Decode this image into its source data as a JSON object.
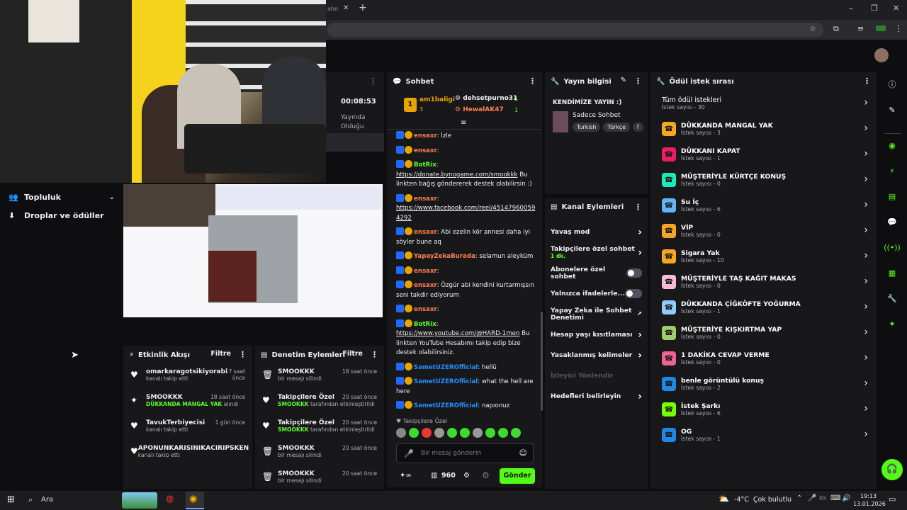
{
  "browser": {
    "tab_fragment": "ahn",
    "new_tab": "+",
    "close_tab": "✕"
  },
  "left_nav": {
    "items": [
      {
        "label": "Topluluk"
      },
      {
        "label": "Droplar ve ödüller"
      }
    ]
  },
  "stream_status": {
    "time": "00:08:53",
    "label": "Yayında\nOlduğu"
  },
  "chat": {
    "title": "Sohbet",
    "leaders": [
      {
        "rank": "1",
        "name": "am1baligi",
        "count": "3"
      },
      {
        "name": "dehsetpurno31",
        "count": "1"
      },
      {
        "name": "HewalAK47",
        "count": "1"
      }
    ],
    "messages": [
      {
        "user": "ensaxr",
        "user_color": "#ff7f50",
        "text": ": İzle"
      },
      {
        "user": "ensaxr",
        "user_color": "#ff7f50",
        "text": ":"
      },
      {
        "user": "BotRix",
        "user_color": "#5cff2a",
        "text": ":",
        "link": "https://donate.bynogame.com/smookkk",
        "after": " Bu linkten bağış göndererek destek olabilirsin :)"
      },
      {
        "user": "ensaxr",
        "user_color": "#ff7f50",
        "text": ":",
        "link": "https://www.facebook.com/reel/451479600594292",
        "after": ""
      },
      {
        "user": "ensaxr",
        "user_color": "#ff7f50",
        "text": ": Abi ezelin kör annesi daha iyi söyler bune aq"
      },
      {
        "user": "YapayZekaBurada",
        "user_color": "#ff7f50",
        "text": ": selamun aleyküm"
      },
      {
        "user": "ensaxr",
        "user_color": "#ff7f50",
        "text": ":"
      },
      {
        "user": "ensaxr",
        "user_color": "#ff7f50",
        "text": ": Özgür abi kendini kurtarmışsın seni takdir ediyorum"
      },
      {
        "user": "ensaxr",
        "user_color": "#ff7f50",
        "text": ":"
      },
      {
        "user": "BotRix",
        "user_color": "#5cff2a",
        "text": ":",
        "link": "https://www.youtube.com/@HARD-1men",
        "after": " Bu linkten YouTube Hesabımı takip edip bize destek olabilirsiniz."
      },
      {
        "user": "SametUZEROfficial",
        "user_color": "#1e90ff",
        "text": ": hellü"
      },
      {
        "user": "SametUZEROfficial",
        "user_color": "#1e90ff",
        "text": ": what the hell are here"
      },
      {
        "user": "SametUZEROfficial",
        "user_color": "#1e90ff",
        "text": ": napıonuz"
      }
    ],
    "emote_label": "Takipçilere Özel",
    "input_placeholder": "Bir mesaj gönderin",
    "points": "960",
    "send_label": "Gönder"
  },
  "stream_info": {
    "title": "Yayın bilgisi",
    "stream_title": "KENDİMİZE YAYIN :)",
    "category": "Sadece Sohbet",
    "tags": [
      "Turkish",
      "Türkçe",
      "f"
    ]
  },
  "channel_actions": {
    "title": "Kanal Eylemleri",
    "items": [
      {
        "label": "Yavaş mod",
        "control": "chevron"
      },
      {
        "label": "Takipçilere özel sohbet",
        "sub": "1 dk.",
        "control": "chevron"
      },
      {
        "label": "Abonelere özel sohbet",
        "control": "toggle"
      },
      {
        "label": "Yalnızca ifadelerle...",
        "control": "toggle"
      },
      {
        "label": "Yapay Zeka ile Sohbet Denetimi",
        "control": "external"
      },
      {
        "label": "Hesap yaşı kısıtlaması",
        "control": "chevron"
      },
      {
        "label": "Yasaklanmış kelimeler",
        "control": "chevron"
      },
      {
        "label": "İzleyici Yönlendir",
        "control": "none",
        "disabled": true
      },
      {
        "label": "Hedefleri belirleyin",
        "control": "chevron"
      }
    ]
  },
  "reward_queue": {
    "title": "Ödül istek sırası",
    "all_label": "Tüm ödül istekleri",
    "all_count": "İstek sayısı - 30",
    "rewards": [
      {
        "title": "DÜKKANDA MANGAL YAK",
        "count": "İstek sayısı - 3",
        "color": "#f5a623"
      },
      {
        "title": "DÜKKANI KAPAT",
        "count": "İstek sayısı - 1",
        "color": "#e91e63"
      },
      {
        "title": "MÜŞTERİYLE KÜRTÇE KONUŞ",
        "count": "İstek sayısı - 0",
        "color": "#1de9b6"
      },
      {
        "title": "Su İç",
        "count": "İstek sayısı - 6",
        "color": "#64b5f6"
      },
      {
        "title": "VİP",
        "count": "İstek sayısı - 0",
        "color": "#f5a623"
      },
      {
        "title": "Sigara Yak",
        "count": "İstek sayısı - 10",
        "color": "#f5a623"
      },
      {
        "title": "MÜŞTERİYLE TAŞ KAĞIT MAKAS",
        "count": "İstek sayısı - 0",
        "color": "#f8bbd0"
      },
      {
        "title": "DÜKKANDA ÇİĞKÖFTE YOĞURMA",
        "count": "İstek sayısı - 1",
        "color": "#90caf9"
      },
      {
        "title": "MÜŞTERİYE KIŞKIRTMA YAP",
        "count": "İstek sayısı - 0",
        "color": "#9ccc65"
      },
      {
        "title": "1 DAKİKA CEVAP VERME",
        "count": "İstek sayısı - 0",
        "color": "#f06292"
      },
      {
        "title": "benle görüntülü konuş",
        "count": "İstek sayısı - 2",
        "color": "#1e88e5"
      },
      {
        "title": "İstek Şarkı",
        "count": "İstek sayısı - 6",
        "color": "#76ff03"
      },
      {
        "title": "OG",
        "count": "İstek sayısı - 1",
        "color": "#1e88e5"
      }
    ]
  },
  "activity_feed": {
    "title": "Etkinlik Akışı",
    "filter": "Filtre",
    "events": [
      {
        "name": "omarkaragotsikiyorabi",
        "sub": "kanalı takip etti",
        "time": "17 saat\nönce",
        "icon": "♥"
      },
      {
        "name": "SMOOKKK",
        "sub_green": "DÜKKANDA MANGAL YAK",
        "sub": " alındı",
        "time": "18 saat önce",
        "icon": "✦"
      },
      {
        "name": "TavukTerbiyecisi",
        "sub": "kanalı takip etti",
        "time": "1 gün önce",
        "icon": "♥"
      },
      {
        "name": "APONUNKARISINIKACIRIPSKEN",
        "sub": "kanalı takip etti",
        "time": "",
        "icon": "♥"
      }
    ]
  },
  "mod_actions": {
    "title": "Denetim Eylemleri",
    "filter": "Filtre",
    "events": [
      {
        "name": "SMOOKKK",
        "sub": "bir mesajı silindi",
        "time": "18 saat önce",
        "icon": "🗑"
      },
      {
        "name": "Takipçilere Özel",
        "sub_green": "SMOOKKK",
        "sub": " tarafından etkinleştirildi",
        "time": "20 saat önce",
        "icon": "♥"
      },
      {
        "name": "Takipçilere Özel",
        "sub_green": "SMOOKKK",
        "sub": " tarafından etkinleştirildi",
        "time": "20 saat önce",
        "icon": "♥"
      },
      {
        "name": "SMOOKKK",
        "sub": "bir mesajı silindi",
        "time": "20 saat önce",
        "icon": "🗑"
      },
      {
        "name": "SMOOKKK",
        "sub": "bir mesajı silindi",
        "time": "20 saat önce",
        "icon": "🗑"
      }
    ]
  },
  "taskbar": {
    "search": "Ara",
    "weather": "-4°C  Çok bulutlu",
    "time": "19:13",
    "date": "13.01.2026"
  },
  "colors": {
    "accent": "#53fc18",
    "panel": "#18181b",
    "bg": "#0e0e10"
  }
}
